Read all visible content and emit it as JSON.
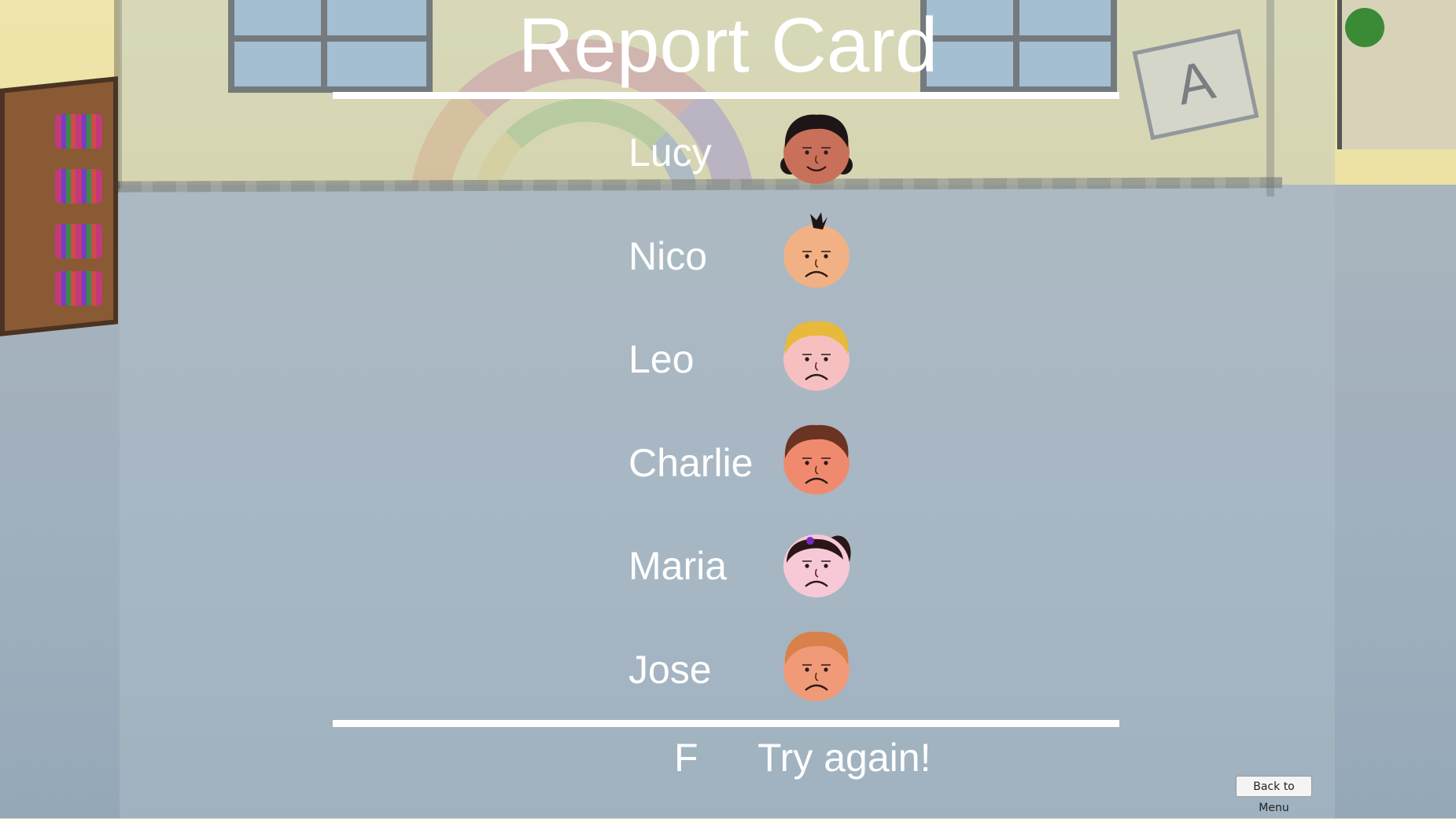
{
  "report": {
    "title": "Report Card",
    "students": [
      {
        "name": "Lucy",
        "expression": "happy-face-icon",
        "skin": "#c9705a",
        "hair": "#1e1616",
        "hair_style": "pigtails"
      },
      {
        "name": "Nico",
        "expression": "sad-face-icon",
        "skin": "#f2b184",
        "hair": "#1e1616",
        "hair_style": "tuft"
      },
      {
        "name": "Leo",
        "expression": "sad-face-icon",
        "skin": "#f7c0c0",
        "hair": "#e8b93a",
        "hair_style": "full"
      },
      {
        "name": "Charlie",
        "expression": "sad-face-icon",
        "skin": "#f08a6e",
        "hair": "#6b3322",
        "hair_style": "full"
      },
      {
        "name": "Maria",
        "expression": "sad-face-icon",
        "skin": "#f7c9d6",
        "hair": "#2a1616",
        "hair_style": "ponytail"
      },
      {
        "name": "Jose",
        "expression": "sad-face-icon",
        "skin": "#f19a78",
        "hair": "#d8814a",
        "hair_style": "full"
      }
    ],
    "grade": "F",
    "message": "Try again!"
  },
  "controls": {
    "back_to_menu_label": "Back to Menu"
  },
  "colors": {
    "text": "#ffffff",
    "rule": "#ffffff",
    "wall": "#ebe0a0",
    "floor": "#a3b1bd"
  }
}
